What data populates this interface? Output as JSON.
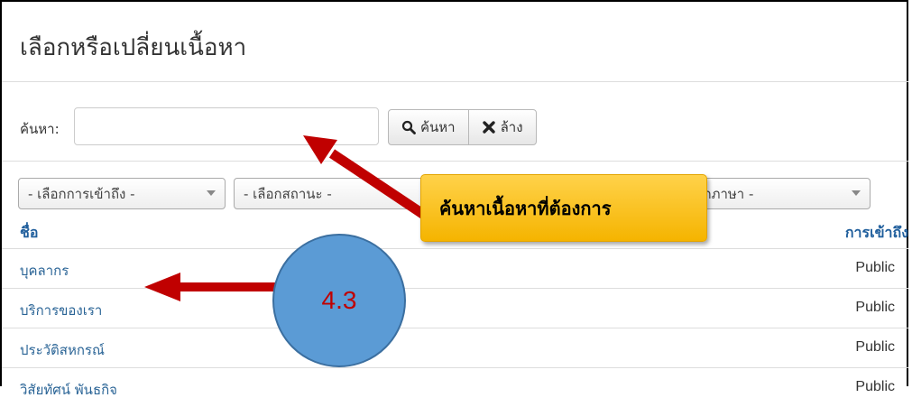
{
  "page": {
    "title": "เลือกหรือเปลี่ยนเนื้อหา"
  },
  "search": {
    "label": "ค้นหา:",
    "value": "",
    "placeholder": "",
    "search_button": "ค้นหา",
    "clear_button": "ล้าง"
  },
  "filters": [
    {
      "selected": "- เลือกการเข้าถึง -"
    },
    {
      "selected": "- เลือกสถานะ -"
    },
    {
      "selected": ""
    },
    {
      "selected": "- เลือกภาษา -"
    }
  ],
  "table": {
    "columns": {
      "name": "ชื่อ",
      "access": "การเข้าถึง"
    },
    "rows": [
      {
        "name": "บุคลากร",
        "access": "Public"
      },
      {
        "name": "บริการของเรา",
        "access": "Public"
      },
      {
        "name": "ประวัติสหกรณ์",
        "access": "Public"
      },
      {
        "name": "วิสัยทัศน์ พันธกิจ",
        "access": "Public"
      }
    ]
  },
  "annotations": {
    "callout_text": "ค้นหาเนื้อหาที่ต้องการ",
    "step_label": "4.3",
    "arrow_color": "#c00000",
    "callout_color": "#f5b400",
    "circle_color": "#5b9bd5"
  }
}
